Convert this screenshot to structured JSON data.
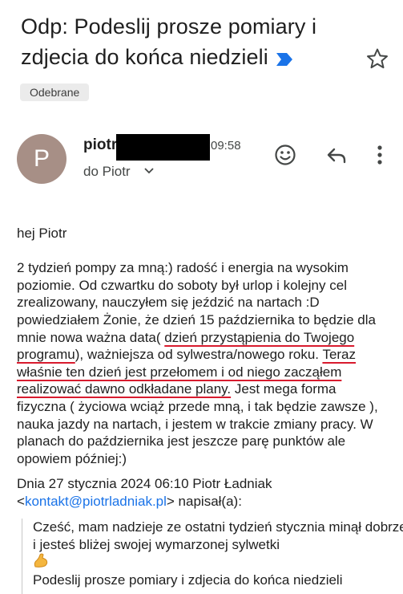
{
  "email": {
    "subject": "Odp: Podeslij prosze pomiary i zdjecia do końca niedzieli",
    "label": "Odebrane",
    "sender_initial": "P",
    "sender_name": "piotr",
    "time": "09:58",
    "recipient": "do Piotr"
  },
  "icons": {
    "important": "important-marker-icon",
    "star": "star-icon",
    "emoji": "smiley-icon",
    "reply": "reply-icon",
    "more": "more-vert-icon",
    "expand": "chevron-down-icon",
    "flex": "flexed-biceps-emoji"
  },
  "body": {
    "greeting": "hej Piotr",
    "p2_part1": "2 tydzień pompy za mną:) radość i energia na wysokim poziomie. Od czwartku do soboty był urlop i kolejny cel zrealizowany, nauczyłem się jeździć na nartach :D powiedziałem Żonie, że dzień 15 października to będzie dla mnie nowa ważna data( ",
    "p2_underlined1": "dzień przystąpienia do Twojego programu",
    "p2_part2": "), ważniejsza od sylwestra/nowego roku. ",
    "p2_underlined2": "Teraz właśnie ten dzień jest przełomem i od niego zacząłem realizować dawno odkładane plany.",
    "p2_part3": " Jest mega forma fizyczna ( życiowa wciąż przede mną, i tak będzie zawsze ), nauka jazdy na nartach, i jestem w trakcie zmiany pracy. W planach do października jest jeszcze parę punktów ale opowiem później:)"
  },
  "quote": {
    "header_prefix": "Dnia 27 stycznia 2024 06:10 Piotr Ładniak",
    "lt": "<",
    "email": "kontakt@piotrladniak.pl",
    "header_suffix": "> napisał(a):",
    "line1": "Cześć, mam nadzieje ze ostatni tydzień stycznia minął dobrze i jesteś bliżej swojej wymarzonej sylwetki",
    "line2": "Podeslij prosze pomiary i zdjecia do końca niedzieli"
  },
  "colors": {
    "important": "#1a73e8",
    "avatar": "#a78f86",
    "underline": "#d81b2e",
    "link": "#1a73e8"
  }
}
